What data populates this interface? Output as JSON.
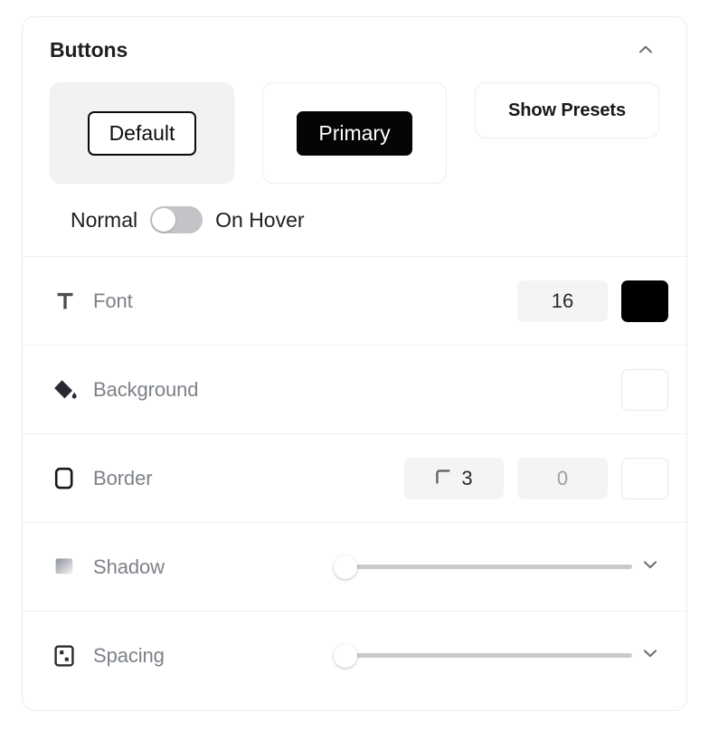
{
  "panel": {
    "title": "Buttons",
    "collapse_icon": "chevron-up-icon"
  },
  "preview": {
    "variants": [
      {
        "label": "Default",
        "style": "outline",
        "selected": true
      },
      {
        "label": "Primary",
        "style": "filled",
        "selected": false
      }
    ],
    "presets_button": {
      "label": "Show Presets",
      "icon": ""
    }
  },
  "state_toggle": {
    "left_label": "Normal",
    "right_label": "On Hover",
    "value": "Normal",
    "checked": false
  },
  "properties": [
    {
      "name": "font",
      "label": "Font",
      "icon": "text-type-icon",
      "size_value": "16",
      "color_value": "#000000"
    },
    {
      "name": "background",
      "label": "Background",
      "icon": "paint-bucket-icon",
      "color_value": "#ffffff"
    },
    {
      "name": "border",
      "label": "Border",
      "icon": "rounded-square-icon",
      "radius_value": "3",
      "width_value": "0",
      "color_value": "#ffffff"
    },
    {
      "name": "shadow",
      "label": "Shadow",
      "icon": "gradient-square-icon",
      "slider_value": 0,
      "expand_icon": "chevron-down-icon"
    },
    {
      "name": "spacing",
      "label": "Spacing",
      "icon": "padding-box-icon",
      "slider_value": 0,
      "expand_icon": "chevron-down-icon"
    }
  ],
  "colors": {
    "panel_border": "#ededed",
    "divider": "#efefef",
    "label_text": "#7d8288",
    "title_text": "#1c1e21",
    "field_bg": "#f4f4f5",
    "track": "#c9cacc",
    "switch_bg": "#c2c4c7",
    "primary_fill": "#050505"
  }
}
